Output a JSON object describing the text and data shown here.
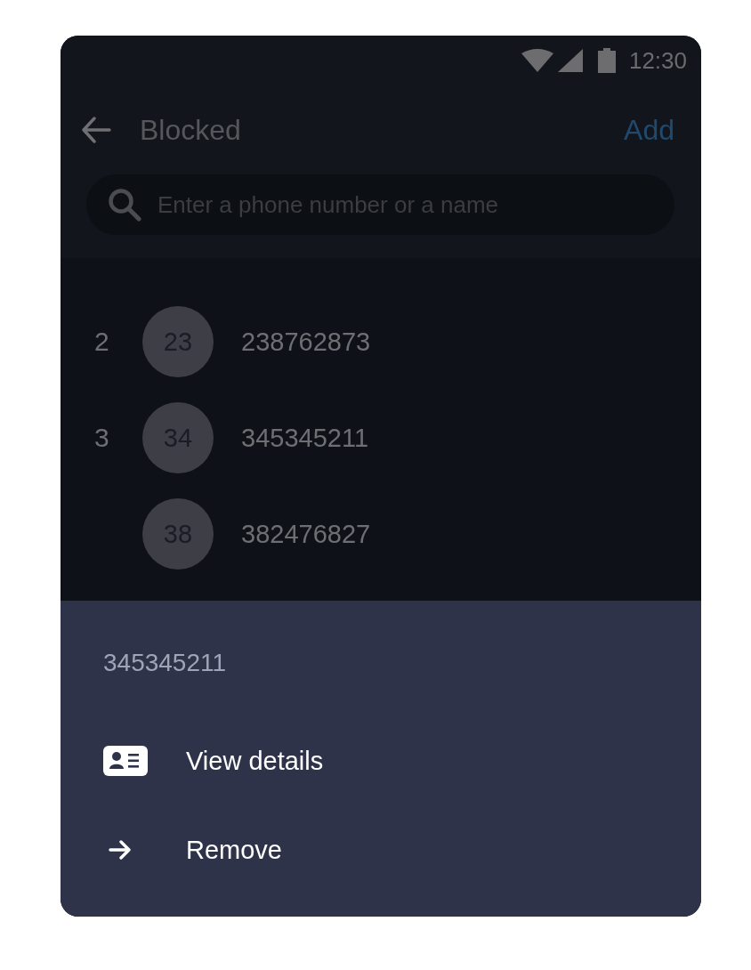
{
  "status_bar": {
    "time": "12:30"
  },
  "toolbar": {
    "title": "Blocked",
    "action": "Add"
  },
  "search": {
    "placeholder": "Enter a phone number or a name"
  },
  "contacts": [
    {
      "section": "2",
      "initials": "23",
      "number": "238762873"
    },
    {
      "section": "3",
      "initials": "34",
      "number": "345345211"
    },
    {
      "initials": "38",
      "number": "382476827"
    }
  ],
  "sheet": {
    "title": "345345211",
    "actions": [
      {
        "kind": "details",
        "label": "View details"
      },
      {
        "kind": "remove",
        "label": "Remove"
      }
    ]
  }
}
